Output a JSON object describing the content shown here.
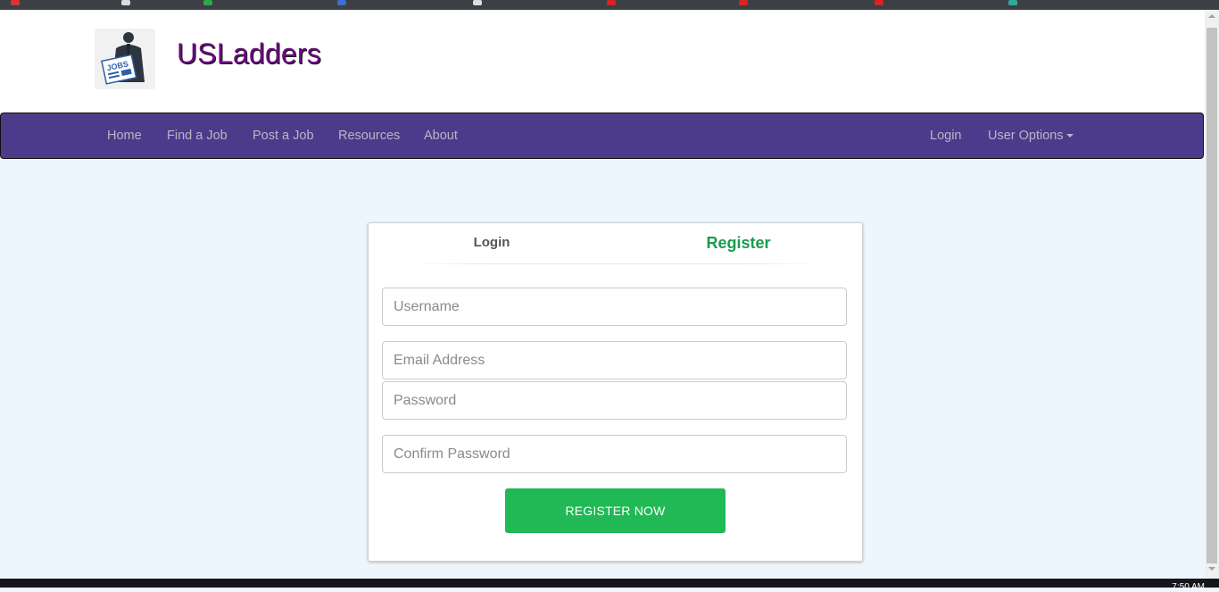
{
  "app": {
    "brand": "USLadders",
    "logo_icon": "jobs-newspaper-man-icon"
  },
  "nav": {
    "left_items": [
      {
        "label": "Home"
      },
      {
        "label": "Find a Job"
      },
      {
        "label": "Post a Job"
      },
      {
        "label": "Resources"
      },
      {
        "label": "About"
      }
    ],
    "login_label": "Login",
    "user_options_label": "User Options"
  },
  "form": {
    "tabs": {
      "login": "Login",
      "register": "Register",
      "active": "register"
    },
    "fields": {
      "username_placeholder": "Username",
      "email_placeholder": "Email Address",
      "password_placeholder": "Password",
      "confirm_password_placeholder": "Confirm Password"
    },
    "submit_label": "REGISTER NOW"
  },
  "system": {
    "clock": "7:50 AM"
  },
  "colors": {
    "navbar": "#4b3b8a",
    "brand_text": "#6a0a7e",
    "active_tab": "#1b9a4f",
    "submit_button": "#20b955",
    "page_background": "#eef6fd"
  }
}
